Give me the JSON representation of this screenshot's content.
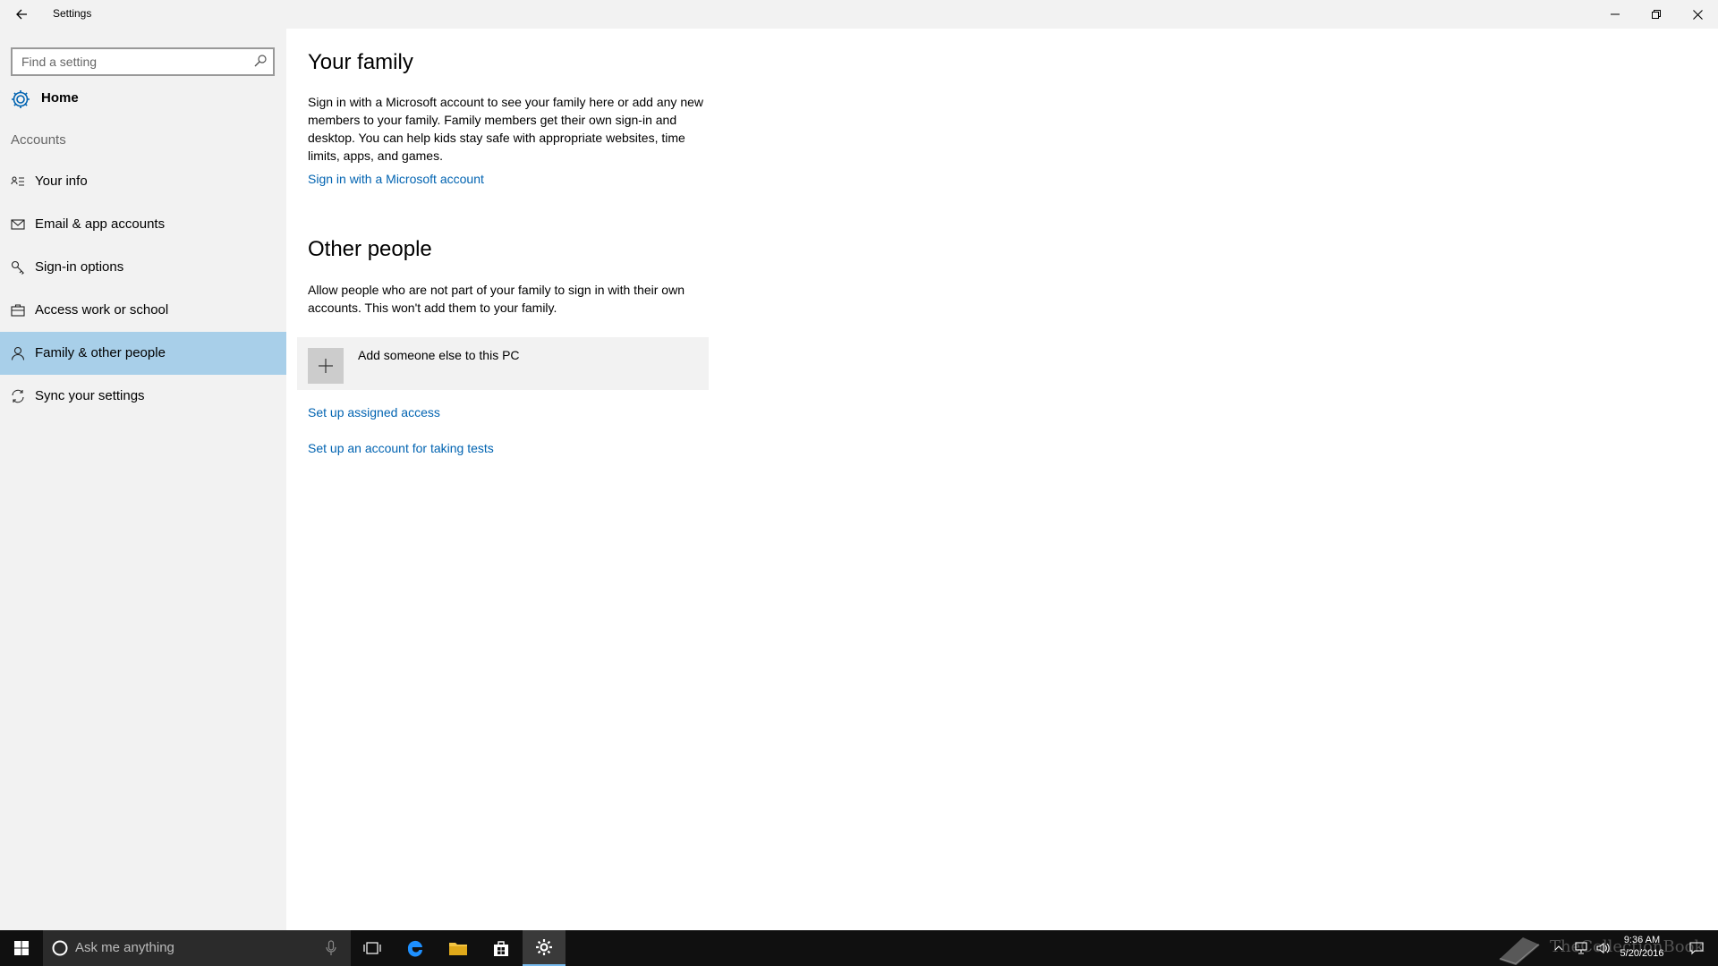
{
  "window": {
    "title": "Settings",
    "back_icon": "back-arrow-icon",
    "minimize_icon": "minimize-icon",
    "maximize_icon": "restore-icon",
    "close_icon": "close-icon"
  },
  "sidebar": {
    "search_placeholder": "Find a setting",
    "search_icon": "search-icon",
    "home_label": "Home",
    "home_icon": "gear-icon",
    "section_label": "Accounts",
    "items": [
      {
        "label": "Your info",
        "icon": "contact-card-icon",
        "active": false
      },
      {
        "label": "Email & app accounts",
        "icon": "mail-icon",
        "active": false
      },
      {
        "label": "Sign-in options",
        "icon": "key-icon",
        "active": false
      },
      {
        "label": "Access work or school",
        "icon": "briefcase-icon",
        "active": false
      },
      {
        "label": "Family & other people",
        "icon": "person-icon",
        "active": true
      },
      {
        "label": "Sync your settings",
        "icon": "sync-icon",
        "active": false
      }
    ],
    "active_color": "#a8cfe9"
  },
  "main": {
    "family_heading": "Your family",
    "family_text": "Sign in with a Microsoft account to see your family here or add any new members to your family. Family members get their own sign-in and desktop. You can help kids stay safe with appropriate websites, time limits, apps, and games.",
    "family_link": "Sign in with a Microsoft account",
    "other_heading": "Other people",
    "other_text": "Allow people who are not part of your family to sign in with their own accounts. This won't add them to your family.",
    "add_someone_label": "Add someone else to this PC",
    "add_icon": "plus-icon",
    "assigned_access_link": "Set up assigned access",
    "tests_account_link": "Set up an account for taking tests",
    "link_color": "#0063b1"
  },
  "taskbar": {
    "start_icon": "windows-start-icon",
    "search_placeholder": "Ask me anything",
    "cortana_icon": "cortana-circle-icon",
    "mic_icon": "microphone-icon",
    "pinned": [
      {
        "name": "task-view-icon"
      },
      {
        "name": "edge-browser-icon"
      },
      {
        "name": "file-explorer-icon"
      },
      {
        "name": "store-icon"
      },
      {
        "name": "settings-gear-icon",
        "active": true
      }
    ],
    "tray_icons": [
      "chevron-up-icon",
      "network-icon",
      "volume-icon"
    ],
    "time": "9:36 AM",
    "date": "5/20/2016",
    "notification_icon": "action-center-icon",
    "watermark": "TheCollectionBook"
  }
}
